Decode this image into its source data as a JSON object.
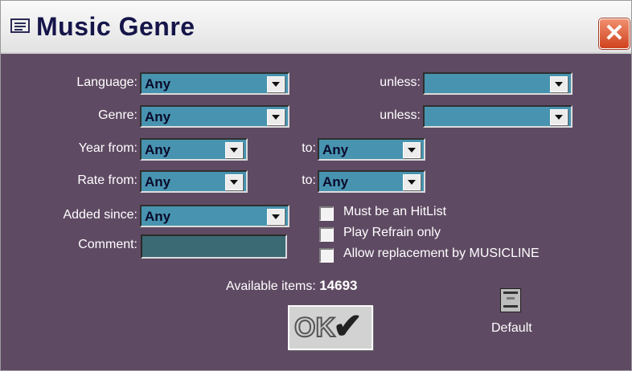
{
  "window": {
    "title": "Music Genre"
  },
  "fields": {
    "language": {
      "label": "Language:",
      "value": "Any",
      "unless_label": "unless:",
      "unless_value": ""
    },
    "genre": {
      "label": "Genre:",
      "value": "Any",
      "unless_label": "unless:",
      "unless_value": ""
    },
    "year": {
      "label": "Year from:",
      "from": "Any",
      "to_label": "to:",
      "to": "Any"
    },
    "rate": {
      "label": "Rate from:",
      "from": "Any",
      "to_label": "to:",
      "to": "Any"
    },
    "added_since": {
      "label": "Added since:",
      "value": "Any"
    },
    "comment": {
      "label": "Comment:",
      "value": ""
    }
  },
  "checkboxes": [
    {
      "label": "Must be an HitList",
      "checked": false
    },
    {
      "label": "Play Refrain only",
      "checked": false
    },
    {
      "label": "Allow replacement by MUSICLINE",
      "checked": false
    }
  ],
  "available": {
    "label": "Available items:",
    "count": "14693"
  },
  "buttons": {
    "ok": "OK",
    "default": "Default"
  },
  "colors": {
    "background": "#5f4a63",
    "combo": "#4893b0",
    "comment_field": "#3b6a74"
  }
}
